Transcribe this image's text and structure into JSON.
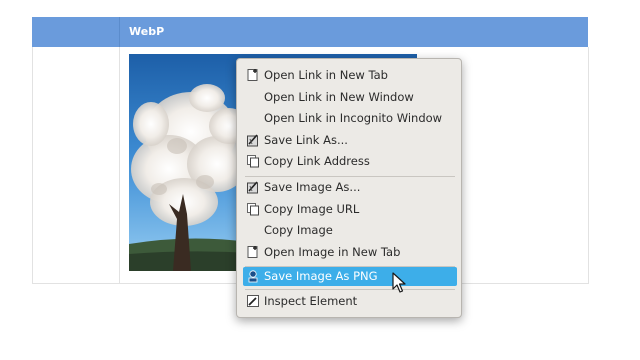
{
  "table": {
    "header_label": "WebP"
  },
  "context_menu": {
    "items": [
      {
        "label": "Open Link in New Tab",
        "icon": "new-tab-icon"
      },
      {
        "label": "Open Link in New Window",
        "icon": ""
      },
      {
        "label": "Open Link in Incognito Window",
        "icon": ""
      },
      {
        "label": "Save Link As...",
        "icon": "save-as-icon"
      },
      {
        "label": "Copy Link Address",
        "icon": "copy-icon"
      },
      {
        "label": "Save Image As...",
        "icon": "save-as-icon"
      },
      {
        "label": "Copy Image URL",
        "icon": "copy-icon"
      },
      {
        "label": "Copy Image",
        "icon": ""
      },
      {
        "label": "Open Image in New Tab",
        "icon": "new-tab-icon"
      },
      {
        "label": "Save Image As PNG",
        "icon": "save-png-icon",
        "highlighted": true
      },
      {
        "label": "Inspect Element",
        "icon": "inspect-icon"
      }
    ]
  },
  "colors": {
    "header": "#6a9bdc",
    "highlight": "#3daee9",
    "menu_bg": "#eceae6"
  }
}
